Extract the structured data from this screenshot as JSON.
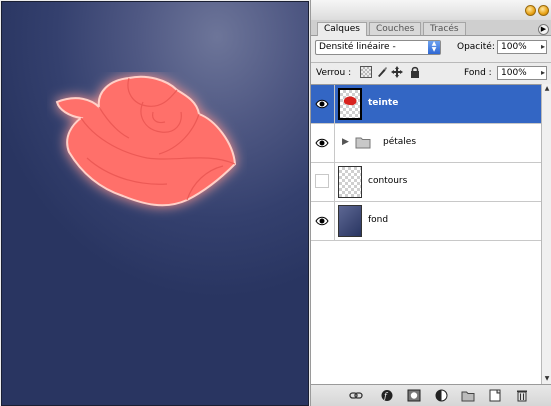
{
  "panel": {
    "tabs": [
      {
        "label": "Calques",
        "active": true
      },
      {
        "label": "Couches",
        "active": false
      },
      {
        "label": "Tracés",
        "active": false
      }
    ],
    "blend_mode": "Densité linéaire -",
    "opacity_label": "Opacité:",
    "opacity_value": "100%",
    "lock_label": "Verrou :",
    "fill_label": "Fond :",
    "fill_value": "100%"
  },
  "layers": [
    {
      "name": "teinte",
      "visible": true,
      "selected": true,
      "type": "paint"
    },
    {
      "name": "pétales",
      "visible": true,
      "selected": false,
      "type": "group"
    },
    {
      "name": "contours",
      "visible": false,
      "selected": false,
      "type": "transparent"
    },
    {
      "name": "fond",
      "visible": true,
      "selected": false,
      "type": "gradient"
    }
  ],
  "colors": {
    "selection": "#3366c4",
    "canvas_dark": "#293561",
    "canvas_light": "#6d7599",
    "rose": "#ff6f6a"
  }
}
